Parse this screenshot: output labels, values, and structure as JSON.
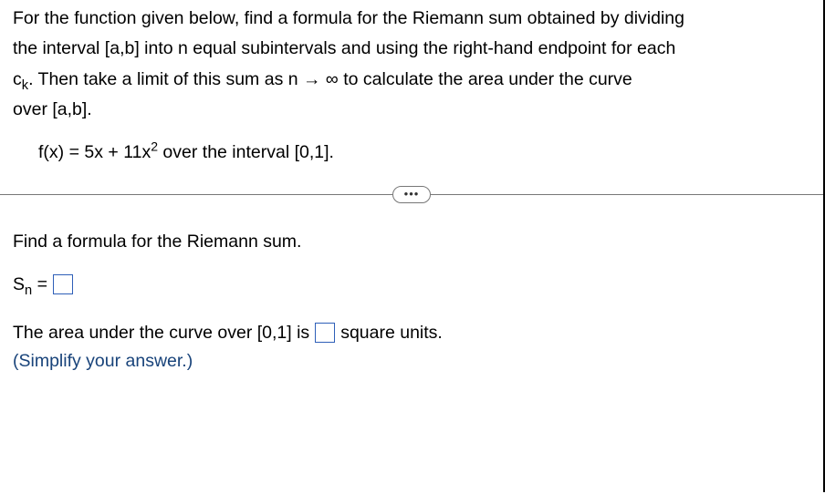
{
  "problem": {
    "intro_line1": "For the function given below, find a formula for the Riemann sum obtained by dividing",
    "intro_line2_pre": "the interval [a,b] into n equal subintervals and using the right-hand endpoint for each",
    "intro_line3_pre": "c",
    "intro_line3_sub": "k",
    "intro_line3_post": ". Then take a limit of this sum as n → ∞ to calculate the area under the curve",
    "intro_line4": "over [a,b].",
    "function_pre": "f(x) = 5x + 11x",
    "function_sup": "2",
    "function_post": " over the interval [0,1]."
  },
  "dots": "•••",
  "section1": {
    "prompt": "Find a formula for the Riemann sum.",
    "label_pre": "S",
    "label_sub": "n",
    "label_post": " ="
  },
  "section2": {
    "text_pre": "The area under the curve over [0,1] is",
    "text_post": "square units.",
    "hint": "(Simplify your answer.)"
  },
  "chart_data": {
    "type": "table",
    "function": "f(x) = 5x + 11x^2",
    "interval": [
      0,
      1
    ],
    "method": "right-hand Riemann sum",
    "subintervals": "n"
  }
}
